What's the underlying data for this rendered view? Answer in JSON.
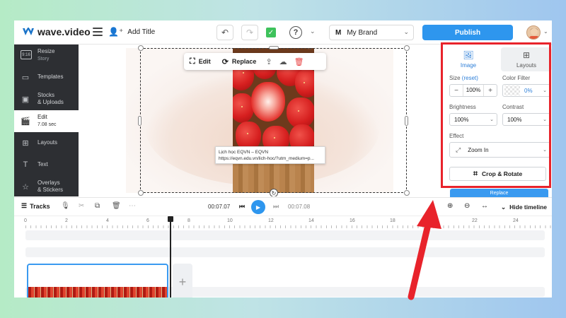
{
  "app": {
    "name": "wave.video",
    "add_title": "Add Title",
    "brand": "My Brand",
    "brand_initial": "M",
    "publish": "Publish"
  },
  "sidebar": {
    "items": [
      {
        "label": "Resize",
        "sub": "Story",
        "icon": "aspect-ratio-icon",
        "icon_text": "9:16"
      },
      {
        "label": "Templates",
        "icon": "templates-icon"
      },
      {
        "label": "Stocks",
        "label2": "& Uploads",
        "icon": "image-icon"
      },
      {
        "label": "Edit",
        "sub": "7.08 sec",
        "icon": "clapper-icon"
      },
      {
        "label": "Layouts",
        "icon": "layouts-icon"
      },
      {
        "label": "Text",
        "icon": "text-icon"
      },
      {
        "label": "Overlays",
        "label2": "& Stickers",
        "icon": "star-icon"
      }
    ]
  },
  "canvas": {
    "toolbar": {
      "edit": "Edit",
      "replace": "Replace"
    },
    "tooltip": {
      "line1": "Lịch học EQVN – EQVN",
      "line2": "https://eqvn.edu.vn/lich-hoc/?utm_medium=p..."
    }
  },
  "panel": {
    "tabs": {
      "image": "Image",
      "layouts": "Layouts"
    },
    "size_label": "Size",
    "size_reset": "(reset)",
    "size_value": "100%",
    "filter_label": "Color Filter",
    "filter_value": "0%",
    "brightness_label": "Brightness",
    "brightness_value": "100%",
    "contrast_label": "Contrast",
    "contrast_value": "100%",
    "effect_label": "Effect",
    "effect_value": "Zoom In",
    "crop_label": "Crop & Rotate",
    "replace_strip": "Replace"
  },
  "timeline_bar": {
    "tracks": "Tracks",
    "current_time": "00:07.07",
    "total_time": "00:07.08",
    "hide_timeline": "Hide timeline"
  },
  "ruler": [
    "0",
    "2",
    "4",
    "6",
    "8",
    "10",
    "12",
    "14",
    "16",
    "18",
    "20",
    "22",
    "24"
  ],
  "colors": {
    "accent": "#2e96ee",
    "highlight": "#e8232b",
    "sidebar": "#2d2f33"
  }
}
